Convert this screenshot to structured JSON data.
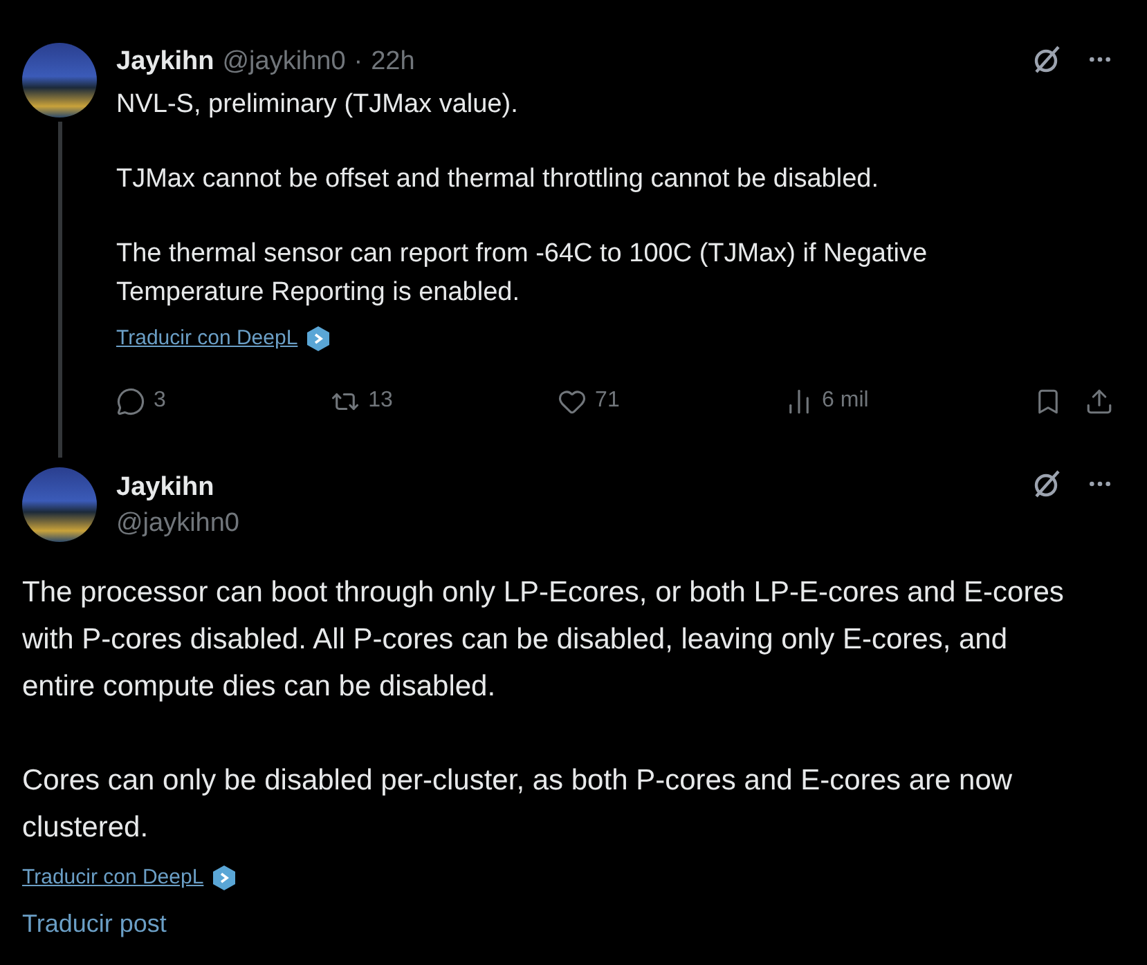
{
  "posts": [
    {
      "name": "Jaykihn",
      "handle": "@jaykihn0",
      "separator": "·",
      "time": "22h",
      "kind": "thread",
      "paragraphs": [
        "NVL-S, preliminary (TJMax value).",
        "TJMax cannot be offset and thermal throttling cannot be disabled.",
        "The thermal sensor can report from -64C to 100C (TJMax) if Negative Temperature Reporting is enabled."
      ],
      "translate_deepl": "Traducir con DeepL",
      "actions": {
        "replies": "3",
        "reposts": "13",
        "likes": "71",
        "views": "6 mil"
      }
    },
    {
      "name": "Jaykihn",
      "handle": "@jaykihn0",
      "kind": "focus",
      "paragraphs": [
        "The processor can boot through only LP-Ecores, or both LP-E-cores and E-cores with P-cores disabled. All P-cores can be disabled, leaving only E-cores, and entire compute dies can be disabled.",
        "Cores can only be disabled per-cluster, as both P-cores and E-cores are now clustered."
      ],
      "translate_deepl": "Traducir con DeepL",
      "translate_post": "Traducir post"
    }
  ]
}
